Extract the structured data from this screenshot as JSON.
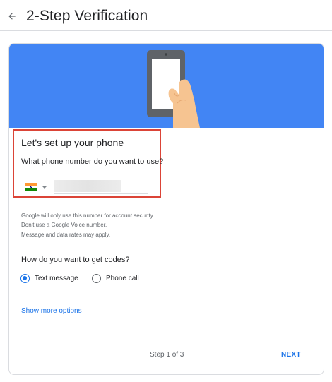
{
  "header": {
    "title": "2-Step Verification",
    "back_icon": "arrow-left-icon"
  },
  "hero": {
    "illustration": "hand-holding-phone",
    "background_color": "#4285f4"
  },
  "setup": {
    "heading": "Let's set up your phone",
    "question": "What phone number do you want to use?",
    "country_flag": "india-flag-icon",
    "phone_value": "",
    "highlight_color": "#db4437"
  },
  "info": {
    "line1": "Google will only use this number for account security.",
    "line2": "Don't use a Google Voice number.",
    "line3": "Message and data rates may apply."
  },
  "codes": {
    "question": "How do you want to get codes?",
    "options": [
      {
        "label": "Text message",
        "selected": true
      },
      {
        "label": "Phone call",
        "selected": false
      }
    ]
  },
  "more_options_label": "Show more options",
  "footer": {
    "step": "Step 1 of 3",
    "next_label": "NEXT"
  },
  "colors": {
    "accent": "#1a73e8",
    "text": "#202124",
    "secondary_text": "#5f6368"
  }
}
